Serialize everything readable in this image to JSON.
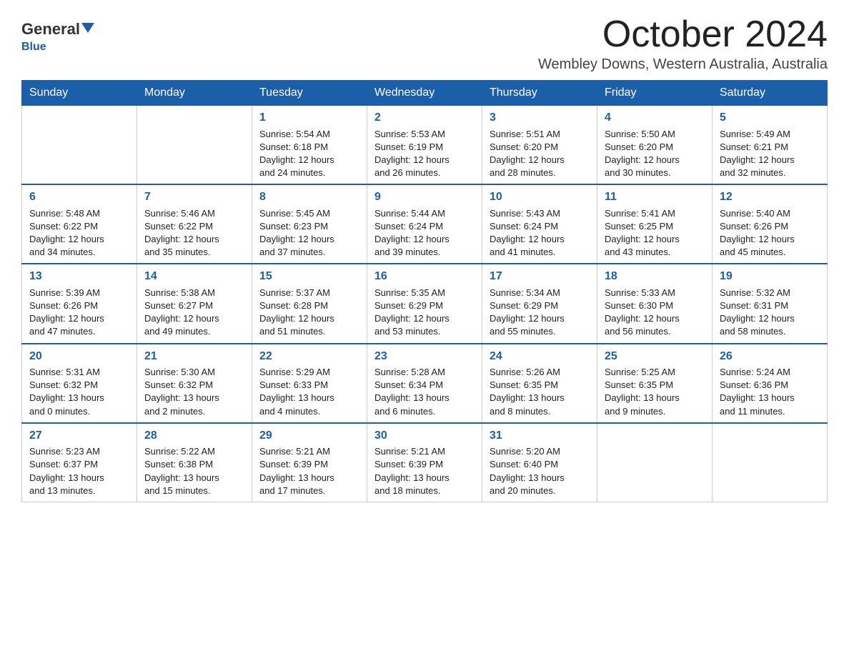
{
  "header": {
    "logo_general": "General",
    "logo_blue": "Blue",
    "month_title": "October 2024",
    "location": "Wembley Downs, Western Australia, Australia"
  },
  "days_of_week": [
    "Sunday",
    "Monday",
    "Tuesday",
    "Wednesday",
    "Thursday",
    "Friday",
    "Saturday"
  ],
  "weeks": [
    [
      {
        "day": "",
        "info": ""
      },
      {
        "day": "",
        "info": ""
      },
      {
        "day": "1",
        "info": "Sunrise: 5:54 AM\nSunset: 6:18 PM\nDaylight: 12 hours\nand 24 minutes."
      },
      {
        "day": "2",
        "info": "Sunrise: 5:53 AM\nSunset: 6:19 PM\nDaylight: 12 hours\nand 26 minutes."
      },
      {
        "day": "3",
        "info": "Sunrise: 5:51 AM\nSunset: 6:20 PM\nDaylight: 12 hours\nand 28 minutes."
      },
      {
        "day": "4",
        "info": "Sunrise: 5:50 AM\nSunset: 6:20 PM\nDaylight: 12 hours\nand 30 minutes."
      },
      {
        "day": "5",
        "info": "Sunrise: 5:49 AM\nSunset: 6:21 PM\nDaylight: 12 hours\nand 32 minutes."
      }
    ],
    [
      {
        "day": "6",
        "info": "Sunrise: 5:48 AM\nSunset: 6:22 PM\nDaylight: 12 hours\nand 34 minutes."
      },
      {
        "day": "7",
        "info": "Sunrise: 5:46 AM\nSunset: 6:22 PM\nDaylight: 12 hours\nand 35 minutes."
      },
      {
        "day": "8",
        "info": "Sunrise: 5:45 AM\nSunset: 6:23 PM\nDaylight: 12 hours\nand 37 minutes."
      },
      {
        "day": "9",
        "info": "Sunrise: 5:44 AM\nSunset: 6:24 PM\nDaylight: 12 hours\nand 39 minutes."
      },
      {
        "day": "10",
        "info": "Sunrise: 5:43 AM\nSunset: 6:24 PM\nDaylight: 12 hours\nand 41 minutes."
      },
      {
        "day": "11",
        "info": "Sunrise: 5:41 AM\nSunset: 6:25 PM\nDaylight: 12 hours\nand 43 minutes."
      },
      {
        "day": "12",
        "info": "Sunrise: 5:40 AM\nSunset: 6:26 PM\nDaylight: 12 hours\nand 45 minutes."
      }
    ],
    [
      {
        "day": "13",
        "info": "Sunrise: 5:39 AM\nSunset: 6:26 PM\nDaylight: 12 hours\nand 47 minutes."
      },
      {
        "day": "14",
        "info": "Sunrise: 5:38 AM\nSunset: 6:27 PM\nDaylight: 12 hours\nand 49 minutes."
      },
      {
        "day": "15",
        "info": "Sunrise: 5:37 AM\nSunset: 6:28 PM\nDaylight: 12 hours\nand 51 minutes."
      },
      {
        "day": "16",
        "info": "Sunrise: 5:35 AM\nSunset: 6:29 PM\nDaylight: 12 hours\nand 53 minutes."
      },
      {
        "day": "17",
        "info": "Sunrise: 5:34 AM\nSunset: 6:29 PM\nDaylight: 12 hours\nand 55 minutes."
      },
      {
        "day": "18",
        "info": "Sunrise: 5:33 AM\nSunset: 6:30 PM\nDaylight: 12 hours\nand 56 minutes."
      },
      {
        "day": "19",
        "info": "Sunrise: 5:32 AM\nSunset: 6:31 PM\nDaylight: 12 hours\nand 58 minutes."
      }
    ],
    [
      {
        "day": "20",
        "info": "Sunrise: 5:31 AM\nSunset: 6:32 PM\nDaylight: 13 hours\nand 0 minutes."
      },
      {
        "day": "21",
        "info": "Sunrise: 5:30 AM\nSunset: 6:32 PM\nDaylight: 13 hours\nand 2 minutes."
      },
      {
        "day": "22",
        "info": "Sunrise: 5:29 AM\nSunset: 6:33 PM\nDaylight: 13 hours\nand 4 minutes."
      },
      {
        "day": "23",
        "info": "Sunrise: 5:28 AM\nSunset: 6:34 PM\nDaylight: 13 hours\nand 6 minutes."
      },
      {
        "day": "24",
        "info": "Sunrise: 5:26 AM\nSunset: 6:35 PM\nDaylight: 13 hours\nand 8 minutes."
      },
      {
        "day": "25",
        "info": "Sunrise: 5:25 AM\nSunset: 6:35 PM\nDaylight: 13 hours\nand 9 minutes."
      },
      {
        "day": "26",
        "info": "Sunrise: 5:24 AM\nSunset: 6:36 PM\nDaylight: 13 hours\nand 11 minutes."
      }
    ],
    [
      {
        "day": "27",
        "info": "Sunrise: 5:23 AM\nSunset: 6:37 PM\nDaylight: 13 hours\nand 13 minutes."
      },
      {
        "day": "28",
        "info": "Sunrise: 5:22 AM\nSunset: 6:38 PM\nDaylight: 13 hours\nand 15 minutes."
      },
      {
        "day": "29",
        "info": "Sunrise: 5:21 AM\nSunset: 6:39 PM\nDaylight: 13 hours\nand 17 minutes."
      },
      {
        "day": "30",
        "info": "Sunrise: 5:21 AM\nSunset: 6:39 PM\nDaylight: 13 hours\nand 18 minutes."
      },
      {
        "day": "31",
        "info": "Sunrise: 5:20 AM\nSunset: 6:40 PM\nDaylight: 13 hours\nand 20 minutes."
      },
      {
        "day": "",
        "info": ""
      },
      {
        "day": "",
        "info": ""
      }
    ]
  ]
}
